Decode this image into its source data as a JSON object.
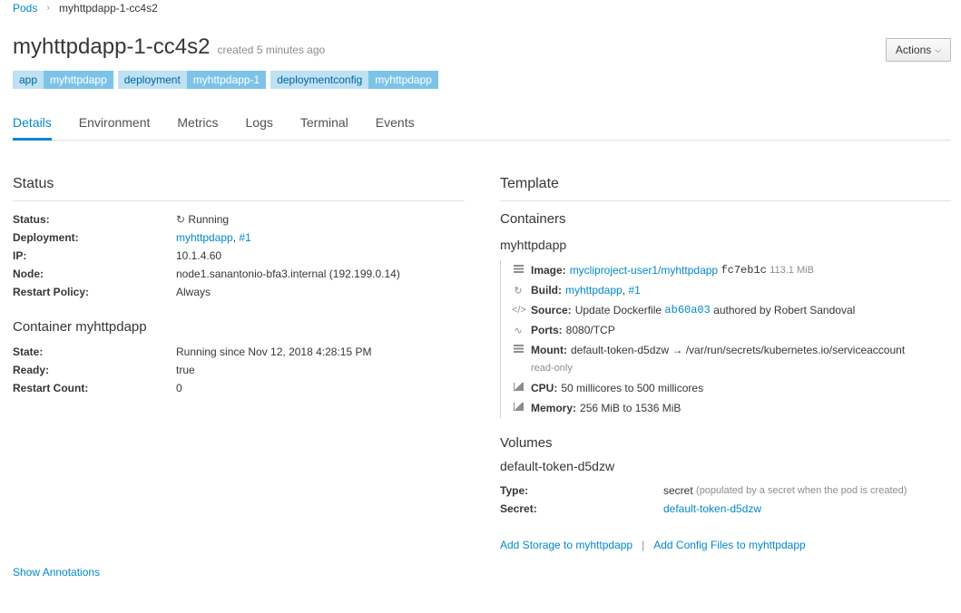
{
  "breadcrumb": {
    "parent": "Pods",
    "separator": "›",
    "current": "myhttpdapp-1-cc4s2"
  },
  "header": {
    "title": "myhttpdapp-1-cc4s2",
    "created": "created 5 minutes ago",
    "actions_label": "Actions"
  },
  "labels": [
    {
      "key": "app",
      "value": "myhttpdapp"
    },
    {
      "key": "deployment",
      "value": "myhttpdapp-1"
    },
    {
      "key": "deploymentconfig",
      "value": "myhttpdapp"
    }
  ],
  "tabs": [
    "Details",
    "Environment",
    "Metrics",
    "Logs",
    "Terminal",
    "Events"
  ],
  "active_tab": "Details",
  "status": {
    "heading": "Status",
    "status_label": "Status:",
    "status_value": "Running",
    "deployment_label": "Deployment:",
    "deployment_link": "myhttpdapp",
    "deployment_sep": ",",
    "deployment_num": "#1",
    "ip_label": "IP:",
    "ip_value": "10.1.4.60",
    "node_label": "Node:",
    "node_value": "node1.sanantonio-bfa3.internal (192.199.0.14)",
    "restart_policy_label": "Restart Policy:",
    "restart_policy_value": "Always"
  },
  "container": {
    "heading": "Container myhttpdapp",
    "state_label": "State:",
    "state_value": "Running since Nov 12, 2018 4:28:15 PM",
    "ready_label": "Ready:",
    "ready_value": "true",
    "restart_count_label": "Restart Count:",
    "restart_count_value": "0"
  },
  "show_annotations": "Show Annotations",
  "template": {
    "heading": "Template",
    "containers_heading": "Containers",
    "container_name": "myhttpdapp",
    "image_label": "Image:",
    "image_link": "mycliproject-user1/myhttpdapp",
    "image_hash": "fc7eb1c",
    "image_size": "113.1 MiB",
    "build_label": "Build:",
    "build_link": "myhttpdapp",
    "build_sep": ",",
    "build_num": "#1",
    "source_label": "Source:",
    "source_text": "Update Dockerfile",
    "source_commit": "ab60a03",
    "source_author": "authored by Robert Sandoval",
    "ports_label": "Ports:",
    "ports_value": "8080/TCP",
    "mount_label": "Mount:",
    "mount_value": "default-token-d5dzw → /var/run/secrets/kubernetes.io/serviceaccount",
    "mount_mode": "read-only",
    "cpu_label": "CPU:",
    "cpu_value": "50 millicores to 500 millicores",
    "memory_label": "Memory:",
    "memory_value": "256 MiB to 1536 MiB"
  },
  "volumes": {
    "heading": "Volumes",
    "name": "default-token-d5dzw",
    "type_label": "Type:",
    "type_value": "secret",
    "type_note": "(populated by a secret when the pod is created)",
    "secret_label": "Secret:",
    "secret_link": "default-token-d5dzw"
  },
  "footer_links": {
    "add_storage": "Add Storage to myhttpdapp",
    "divider": "|",
    "add_config": "Add Config Files to myhttpdapp"
  }
}
